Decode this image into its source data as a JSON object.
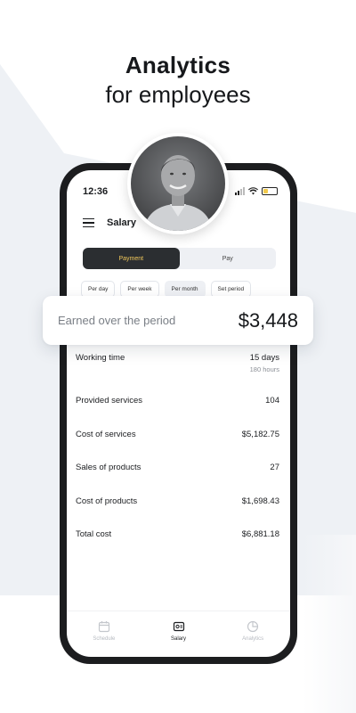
{
  "headline": {
    "line1": "Analytics",
    "line2": "for employees"
  },
  "status_bar": {
    "time": "12:36"
  },
  "header": {
    "title": "Salary"
  },
  "segment": {
    "options": [
      "Payment",
      "Pay"
    ],
    "selected": "Payment"
  },
  "period_chips": {
    "options": [
      "Per day",
      "Per week",
      "Per month",
      "Set period"
    ],
    "selected": "Per month"
  },
  "earned_card": {
    "label": "Earned over the period",
    "value": "$3,448"
  },
  "stats": [
    {
      "label": "Working time",
      "value": "15 days",
      "sub": "180 hours"
    },
    {
      "label": "Provided services",
      "value": "104"
    },
    {
      "label": "Cost of services",
      "value": "$5,182.75"
    },
    {
      "label": "Sales of products",
      "value": "27"
    },
    {
      "label": "Cost of products",
      "value": "$1,698.43"
    },
    {
      "label": "Total cost",
      "value": "$6,881.18"
    }
  ],
  "tabbar": {
    "items": [
      {
        "label": "Schedule",
        "icon": "calendar-icon"
      },
      {
        "label": "Salary",
        "icon": "wallet-icon"
      },
      {
        "label": "Analytics",
        "icon": "pie-chart-icon"
      }
    ],
    "active": "Salary"
  },
  "colors": {
    "accent_gold": "#f0c75a",
    "dark": "#2b2e31",
    "background_tint": "#eef1f5"
  }
}
